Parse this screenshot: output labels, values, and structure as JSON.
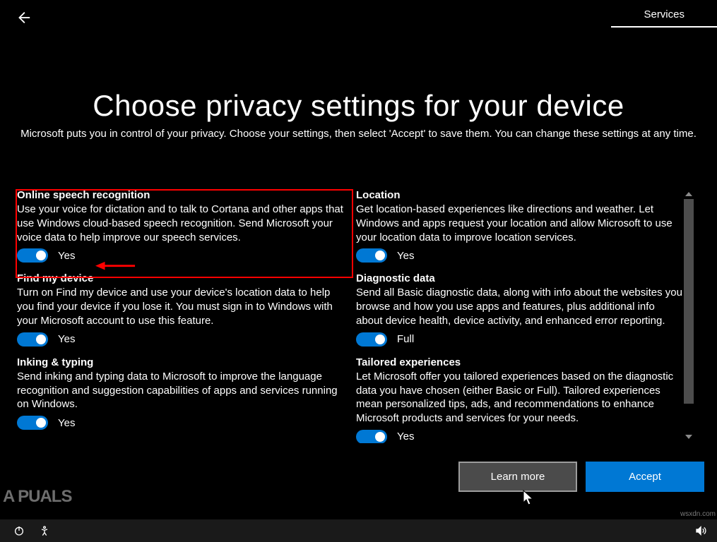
{
  "header": {
    "tab": "Services",
    "title": "Choose privacy settings for your device",
    "subtitle": "Microsoft puts you in control of your privacy. Choose your settings, then select 'Accept' to save them. You can change these settings at any time."
  },
  "settings": {
    "left": [
      {
        "key": "speech",
        "title": "Online speech recognition",
        "desc": "Use your voice for dictation and to talk to Cortana and other apps that use Windows cloud-based speech recognition. Send Microsoft your voice data to help improve our speech services.",
        "toggle_label": "Yes",
        "toggle_on": true
      },
      {
        "key": "find_device",
        "title": "Find my device",
        "desc": "Turn on Find my device and use your device's location data to help you find your device if you lose it. You must sign in to Windows with your Microsoft account to use this feature.",
        "toggle_label": "Yes",
        "toggle_on": true
      },
      {
        "key": "inking",
        "title": "Inking & typing",
        "desc": "Send inking and typing data to Microsoft to improve the language recognition and suggestion capabilities of apps and services running on Windows.",
        "toggle_label": "Yes",
        "toggle_on": true
      }
    ],
    "right": [
      {
        "key": "location",
        "title": "Location",
        "desc": "Get location-based experiences like directions and weather. Let Windows and apps request your location and allow Microsoft to use your location data to improve location services.",
        "toggle_label": "Yes",
        "toggle_on": true
      },
      {
        "key": "diagnostic",
        "title": "Diagnostic data",
        "desc": "Send all Basic diagnostic data, along with info about the websites you browse and how you use apps and features, plus additional info about device health, device activity, and enhanced error reporting.",
        "toggle_label": "Full",
        "toggle_on": true
      },
      {
        "key": "tailored",
        "title": "Tailored experiences",
        "desc": "Let Microsoft offer you tailored experiences based on the diagnostic data you have chosen (either Basic or Full). Tailored experiences mean personalized tips, ads, and recommendations to enhance Microsoft products and services for your needs.",
        "toggle_label": "Yes",
        "toggle_on": true
      }
    ]
  },
  "footer": {
    "learn_more": "Learn more",
    "accept": "Accept"
  },
  "watermark": {
    "main": "A   PUALS",
    "small": "wsxdn.com"
  }
}
